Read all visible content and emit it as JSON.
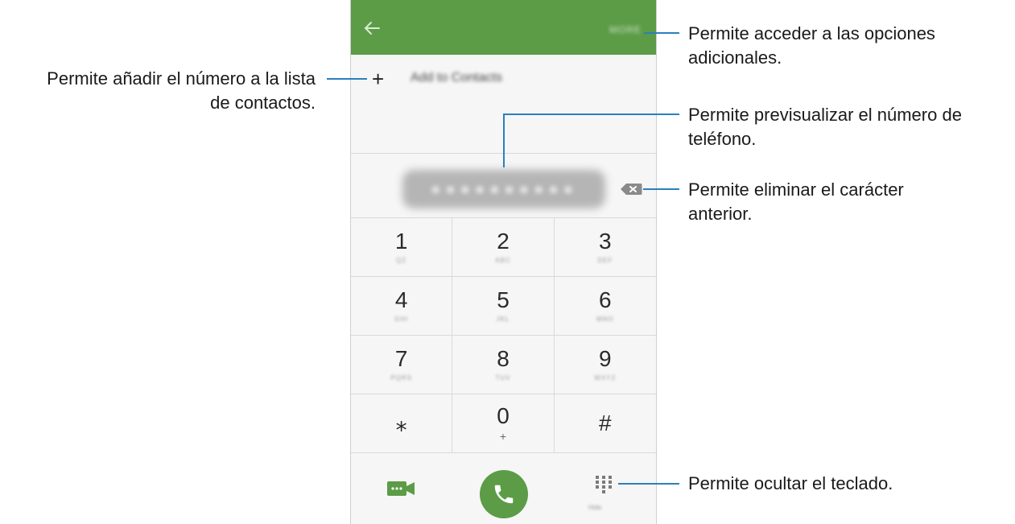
{
  "callouts": {
    "more_options": [
      "Permite acceder a las opciones",
      "adicionales."
    ],
    "add_contact": [
      "Permite añadir el número a la lista",
      "de contactos."
    ],
    "preview": [
      "Permite previsualizar el número de",
      "teléfono."
    ],
    "delete_char": [
      "Permite eliminar el carácter",
      "anterior."
    ],
    "hide_keypad": "Permite ocultar el teclado."
  },
  "phone": {
    "topbar": {
      "back_icon": "arrow-left-icon",
      "more_label": "MORE",
      "color": "#5c9c47"
    },
    "add_row": {
      "plus": "+",
      "label": "Add to Contacts"
    },
    "number_display": "●●●●●●●●●●",
    "keys": [
      {
        "digit": "1",
        "letters": "QZ"
      },
      {
        "digit": "2",
        "letters": "ABC"
      },
      {
        "digit": "3",
        "letters": "DEF"
      },
      {
        "digit": "4",
        "letters": "GHI"
      },
      {
        "digit": "5",
        "letters": "JKL"
      },
      {
        "digit": "6",
        "letters": "MNO"
      },
      {
        "digit": "7",
        "letters": "PQRS"
      },
      {
        "digit": "8",
        "letters": "TUV"
      },
      {
        "digit": "9",
        "letters": "WXYZ"
      },
      {
        "digit": "⁎",
        "letters": ""
      },
      {
        "digit": "0",
        "letters": "+"
      },
      {
        "digit": "#",
        "letters": ""
      }
    ],
    "bottom": {
      "video_icon": "video-call-icon",
      "call_icon": "phone-icon",
      "keypad_icon": "dialpad-icon",
      "keypad_label": "Hide"
    },
    "accent_color": "#5c9c47",
    "line_color": "#2b7fbd"
  }
}
